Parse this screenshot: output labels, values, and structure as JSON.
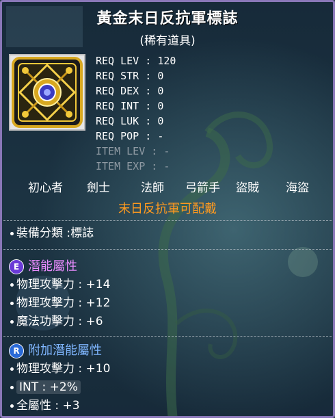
{
  "item": {
    "name": "黃金末日反抗軍標誌",
    "rarity": "(稀有道具)",
    "icon": "gold-emblem-icon",
    "frame_color": "#e6e6e6"
  },
  "requirements": [
    {
      "label": "REQ LEV",
      "value": "120",
      "dim": false
    },
    {
      "label": "REQ STR",
      "value": "0",
      "dim": false
    },
    {
      "label": "REQ DEX",
      "value": "0",
      "dim": false
    },
    {
      "label": "REQ INT",
      "value": "0",
      "dim": false
    },
    {
      "label": "REQ LUK",
      "value": "0",
      "dim": false
    },
    {
      "label": "REQ POP",
      "value": "-",
      "dim": false
    },
    {
      "label": "ITEM LEV",
      "value": "-",
      "dim": true
    },
    {
      "label": "ITEM EXP",
      "value": "-",
      "dim": true
    }
  ],
  "jobs": [
    "初心者",
    "劍士",
    "法師",
    "弓箭手",
    "盜賊",
    "海盜"
  ],
  "restriction": "末日反抗軍可配戴",
  "restriction_color": "#ff9a1f",
  "category": "裝備分類 :標誌",
  "potential": {
    "badge": "E",
    "title": "潛能屬性",
    "title_color": "#e98cff",
    "lines": [
      "物理攻擊力 : +14",
      "物理攻擊力 : +12",
      "魔法功擊力 : +6"
    ]
  },
  "bonus_potential": {
    "badge": "R",
    "title": "附加潛能屬性",
    "title_color": "#7fb6ff",
    "lines": [
      "物理攻擊力 : +10",
      "INT : +2%",
      "全屬性 : +3"
    ]
  }
}
